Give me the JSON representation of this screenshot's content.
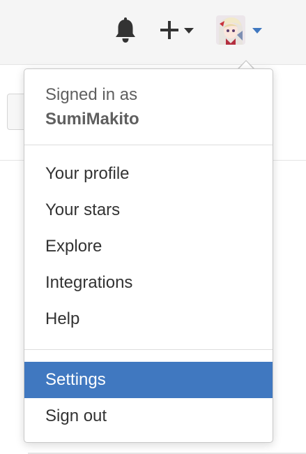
{
  "header": {
    "icons": {
      "notifications": "bell-icon",
      "create_new": "plus-icon",
      "create_caret": "caret-down-icon",
      "user_caret": "caret-down-icon"
    },
    "accent_color": "#4078c0"
  },
  "user_menu": {
    "signed_in_label": "Signed in as",
    "username": "SumiMakito",
    "items": [
      {
        "label": "Your profile"
      },
      {
        "label": "Your stars"
      },
      {
        "label": "Explore"
      },
      {
        "label": "Integrations"
      },
      {
        "label": "Help"
      }
    ],
    "settings_items": [
      {
        "label": "Settings",
        "highlighted": true
      },
      {
        "label": "Sign out"
      }
    ],
    "highlight_color": "#4078c0"
  }
}
